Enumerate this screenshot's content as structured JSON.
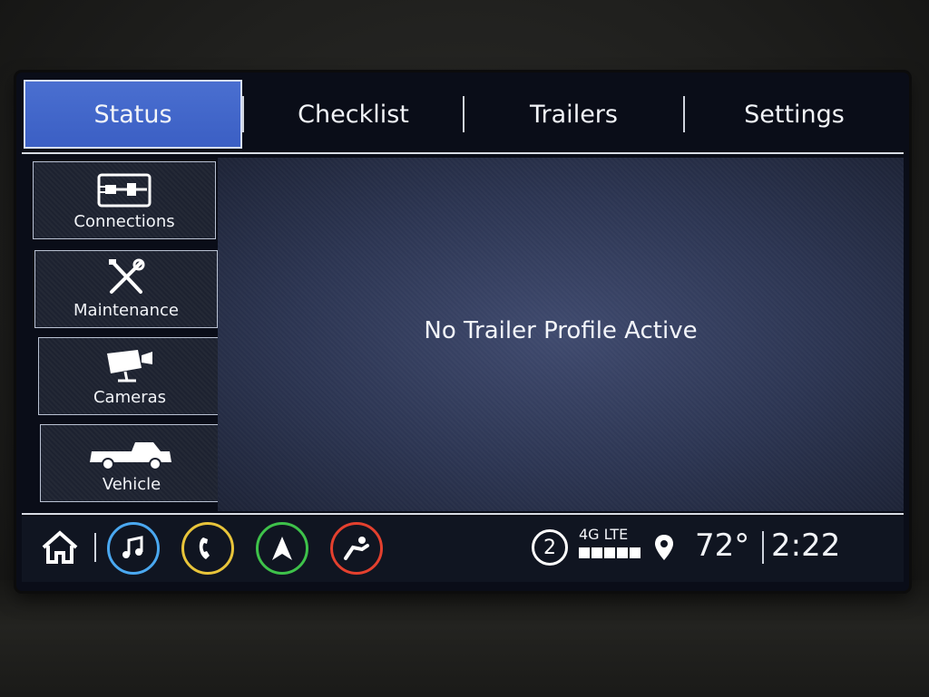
{
  "tabs": [
    {
      "label": "Status",
      "active": true
    },
    {
      "label": "Checklist",
      "active": false
    },
    {
      "label": "Trailers",
      "active": false
    },
    {
      "label": "Settings",
      "active": false
    }
  ],
  "side_menu": [
    {
      "label": "Connections",
      "icon": "plug-connection-icon"
    },
    {
      "label": "Maintenance",
      "icon": "wrench-screwdriver-icon"
    },
    {
      "label": "Cameras",
      "icon": "camera-icon"
    },
    {
      "label": "Vehicle",
      "icon": "pickup-truck-icon"
    }
  ],
  "main": {
    "message": "No Trailer Profile Active"
  },
  "bottom_bar": {
    "apps": [
      {
        "name": "audio",
        "icon": "music-note-icon",
        "color": "#4aa8f0"
      },
      {
        "name": "phone",
        "icon": "phone-icon",
        "color": "#e8c43a"
      },
      {
        "name": "navigation",
        "icon": "navigation-arrow-icon",
        "color": "#3ec24a"
      },
      {
        "name": "seat",
        "icon": "seat-icon",
        "color": "#e4402e"
      }
    ],
    "notification_count": "2",
    "network": "4G LTE",
    "temperature": "72°",
    "time": "2:22"
  }
}
